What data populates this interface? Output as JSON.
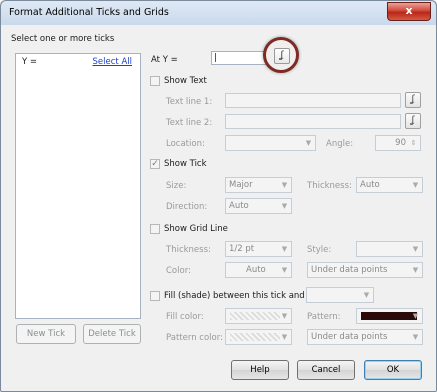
{
  "window": {
    "title": "Format Additional Ticks and Grids",
    "close_glyph": "x"
  },
  "list_panel": {
    "prompt": "Select one or more ticks",
    "items": [
      {
        "label": "Y =",
        "link": "Select All"
      }
    ],
    "new_tick": "New Tick",
    "delete_tick": "Delete Tick"
  },
  "at_y": {
    "label": "At Y =",
    "value": ""
  },
  "show_text": {
    "label": "Show Text",
    "checked": false,
    "text_line1": "Text line 1:",
    "text_line2": "Text line 2:",
    "location": "Location:",
    "angle": "Angle:",
    "angle_value": "90"
  },
  "show_tick": {
    "label": "Show Tick",
    "checked": true,
    "size_label": "Size:",
    "size_value": "Major",
    "thickness_label": "Thickness:",
    "thickness_value": "Auto",
    "direction_label": "Direction:",
    "direction_value": "Auto"
  },
  "show_grid": {
    "label": "Show Grid Line",
    "checked": false,
    "thickness_label": "Thickness:",
    "thickness_value": "1/2 pt",
    "style_label": "Style:",
    "style_value": "",
    "color_label": "Color:",
    "color_value": "Auto",
    "layer_value": "Under data points"
  },
  "fill": {
    "label": "Fill (shade) between this tick and Y =",
    "checked": false,
    "fill_color_label": "Fill color:",
    "pattern_label": "Pattern:",
    "pattern_color_label": "Pattern color:",
    "pattern_swatch_color": "#2a0a08",
    "layer_value": "Under data points"
  },
  "buttons": {
    "help": "Help",
    "cancel": "Cancel",
    "ok": "OK"
  },
  "icons": {
    "formula": "formula-builder-icon"
  },
  "colors": {
    "accent": "#3c7fb1",
    "close": "#c8392b",
    "highlight_ring": "#7d2b25"
  }
}
